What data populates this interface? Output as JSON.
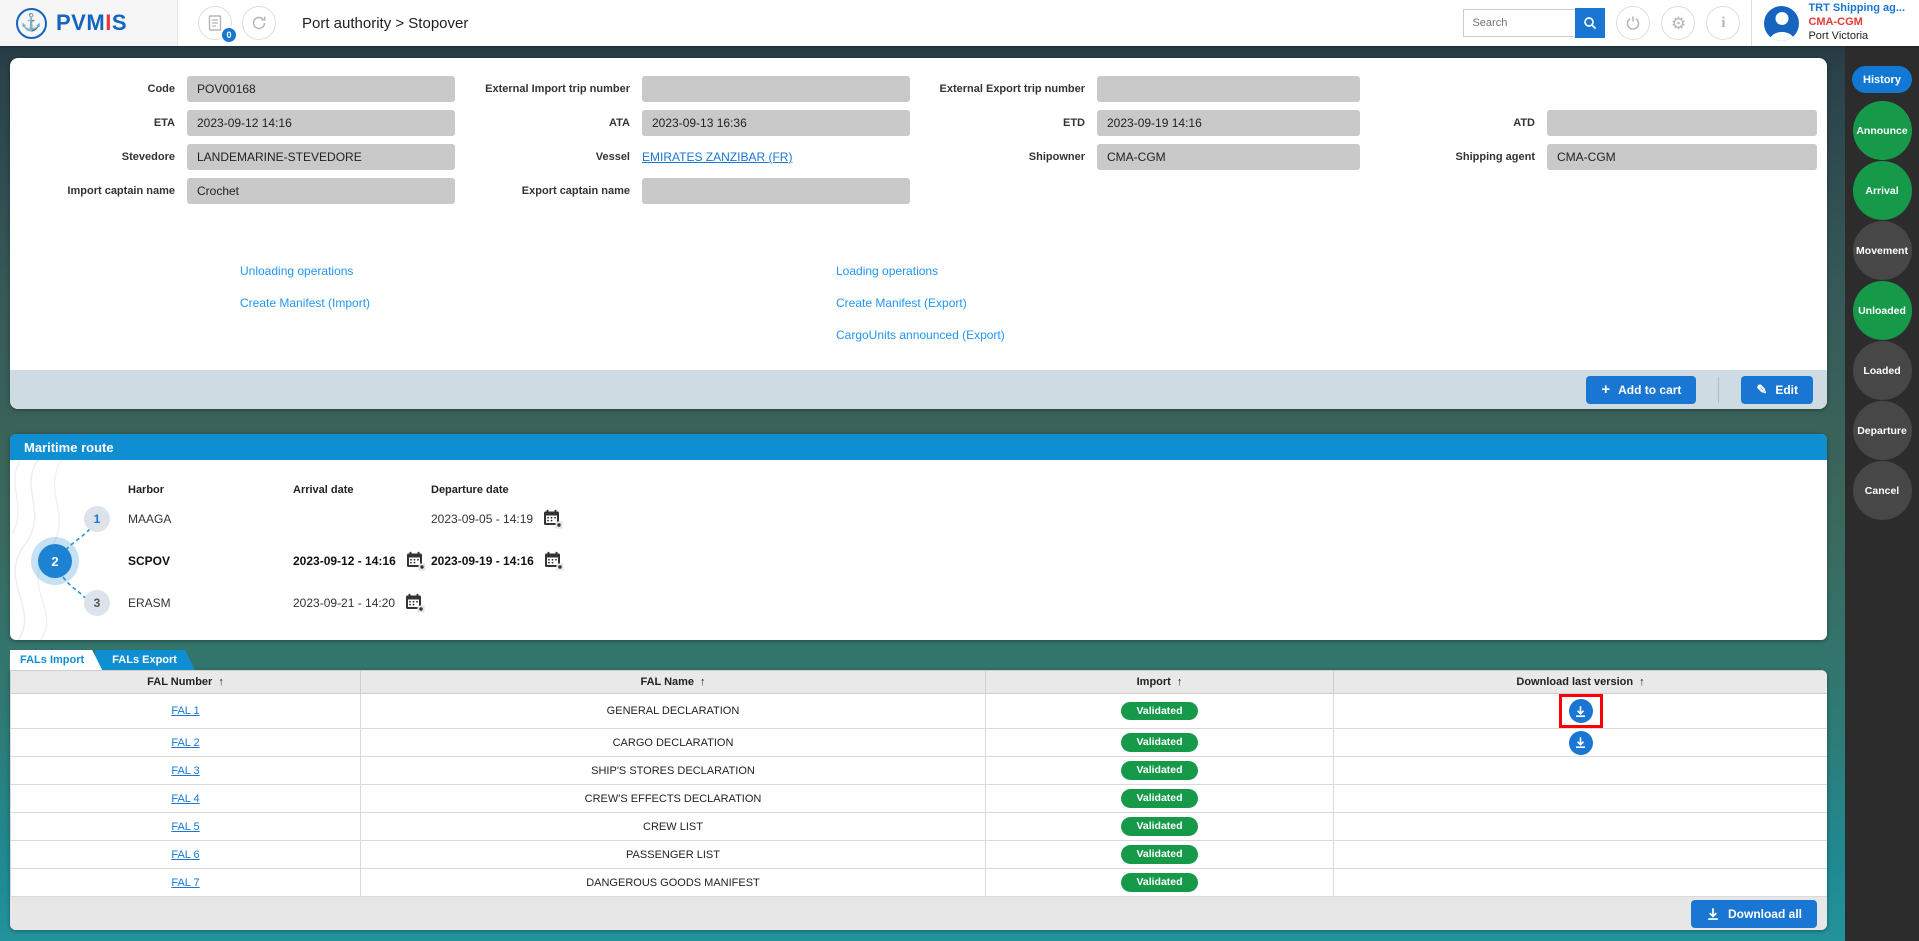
{
  "header": {
    "logo": {
      "p1": "PVM",
      "p2": "I",
      "p3": "S"
    },
    "breadcrumb": "Port authority > Stopover",
    "badge_count": "0",
    "search": {
      "placeholder": "Search"
    },
    "user": {
      "name": "TRT Shipping ag...",
      "org": "CMA-CGM",
      "port": "Port Victoria"
    }
  },
  "icons": {
    "anchor": "⚓",
    "gear": "⚙",
    "info": "i",
    "plus": "+",
    "pencil": "✎"
  },
  "form": {
    "code": {
      "label": "Code",
      "value": "POV00168"
    },
    "ext_import": {
      "label": "External Import trip number",
      "value": ""
    },
    "ext_export": {
      "label": "External Export trip number",
      "value": ""
    },
    "eta": {
      "label": "ETA",
      "value": "2023-09-12 14:16"
    },
    "ata": {
      "label": "ATA",
      "value": "2023-09-13 16:36"
    },
    "etd": {
      "label": "ETD",
      "value": "2023-09-19 14:16"
    },
    "atd": {
      "label": "ATD",
      "value": ""
    },
    "stevedore": {
      "label": "Stevedore",
      "value": "LANDEMARINE-STEVEDORE"
    },
    "vessel": {
      "label": "Vessel",
      "value": "EMIRATES ZANZIBAR (FR)"
    },
    "shipowner": {
      "label": "Shipowner",
      "value": "CMA-CGM"
    },
    "shipping_agent": {
      "label": "Shipping agent",
      "value": "CMA-CGM"
    },
    "import_captain": {
      "label": "Import captain name",
      "value": "Crochet"
    },
    "export_captain": {
      "label": "Export captain name",
      "value": ""
    },
    "links": {
      "unloading": "Unloading operations",
      "manifest_import": "Create Manifest (Import)",
      "loading": "Loading operations",
      "manifest_export": "Create Manifest (Export)",
      "cargounits_export": "CargoUnits announced (Export)"
    },
    "actions": {
      "add_to_cart": "Add to cart",
      "edit": "Edit"
    }
  },
  "maritime": {
    "title": "Maritime route",
    "headers": {
      "harbor": "Harbor",
      "arrival": "Arrival date",
      "departure": "Departure date"
    },
    "stops": [
      {
        "num": "1",
        "harbor": "MAAGA",
        "arrival": "",
        "departure": "2023-09-05 - 14:19"
      },
      {
        "num": "2",
        "harbor": "SCPOV",
        "arrival": "2023-09-12 - 14:16",
        "departure": "2023-09-19 - 14:16"
      },
      {
        "num": "3",
        "harbor": "ERASM",
        "arrival": "2023-09-21 - 14:20",
        "departure": ""
      }
    ]
  },
  "fals": {
    "tabs": {
      "import": "FALs Import",
      "export": "FALs Export"
    },
    "sort_icon": "↑",
    "headers": {
      "number": "FAL Number",
      "name": "FAL Name",
      "status": "Import",
      "download": "Download last version"
    },
    "rows": [
      {
        "number": "FAL 1",
        "name": "GENERAL DECLARATION",
        "status": "Validated"
      },
      {
        "number": "FAL 2",
        "name": "CARGO DECLARATION",
        "status": "Validated"
      },
      {
        "number": "FAL 3",
        "name": "SHIP'S STORES DECLARATION",
        "status": "Validated"
      },
      {
        "number": "FAL 4",
        "name": "CREW'S EFFECTS DECLARATION",
        "status": "Validated"
      },
      {
        "number": "FAL 5",
        "name": "CREW LIST",
        "status": "Validated"
      },
      {
        "number": "FAL 6",
        "name": "PASSENGER LIST",
        "status": "Validated"
      },
      {
        "number": "FAL 7",
        "name": "DANGEROUS GOODS MANIFEST",
        "status": "Validated"
      }
    ],
    "download_all": "Download all"
  },
  "sidebar": {
    "items": [
      {
        "label": "History"
      },
      {
        "label": "Announce"
      },
      {
        "label": "Arrival"
      },
      {
        "label": "Movement"
      },
      {
        "label": "Unloaded"
      },
      {
        "label": "Loaded"
      },
      {
        "label": "Departure"
      },
      {
        "label": "Cancel"
      }
    ]
  },
  "colors": {
    "primary_blue": "#1976d2",
    "section_blue": "#0f8ed2",
    "success_green": "#17994a",
    "danger_red": "#e53935",
    "highlight_red": "#fb0007",
    "sidebar_bg": "#2c2c2c",
    "sidebar_pending": "#474747"
  }
}
